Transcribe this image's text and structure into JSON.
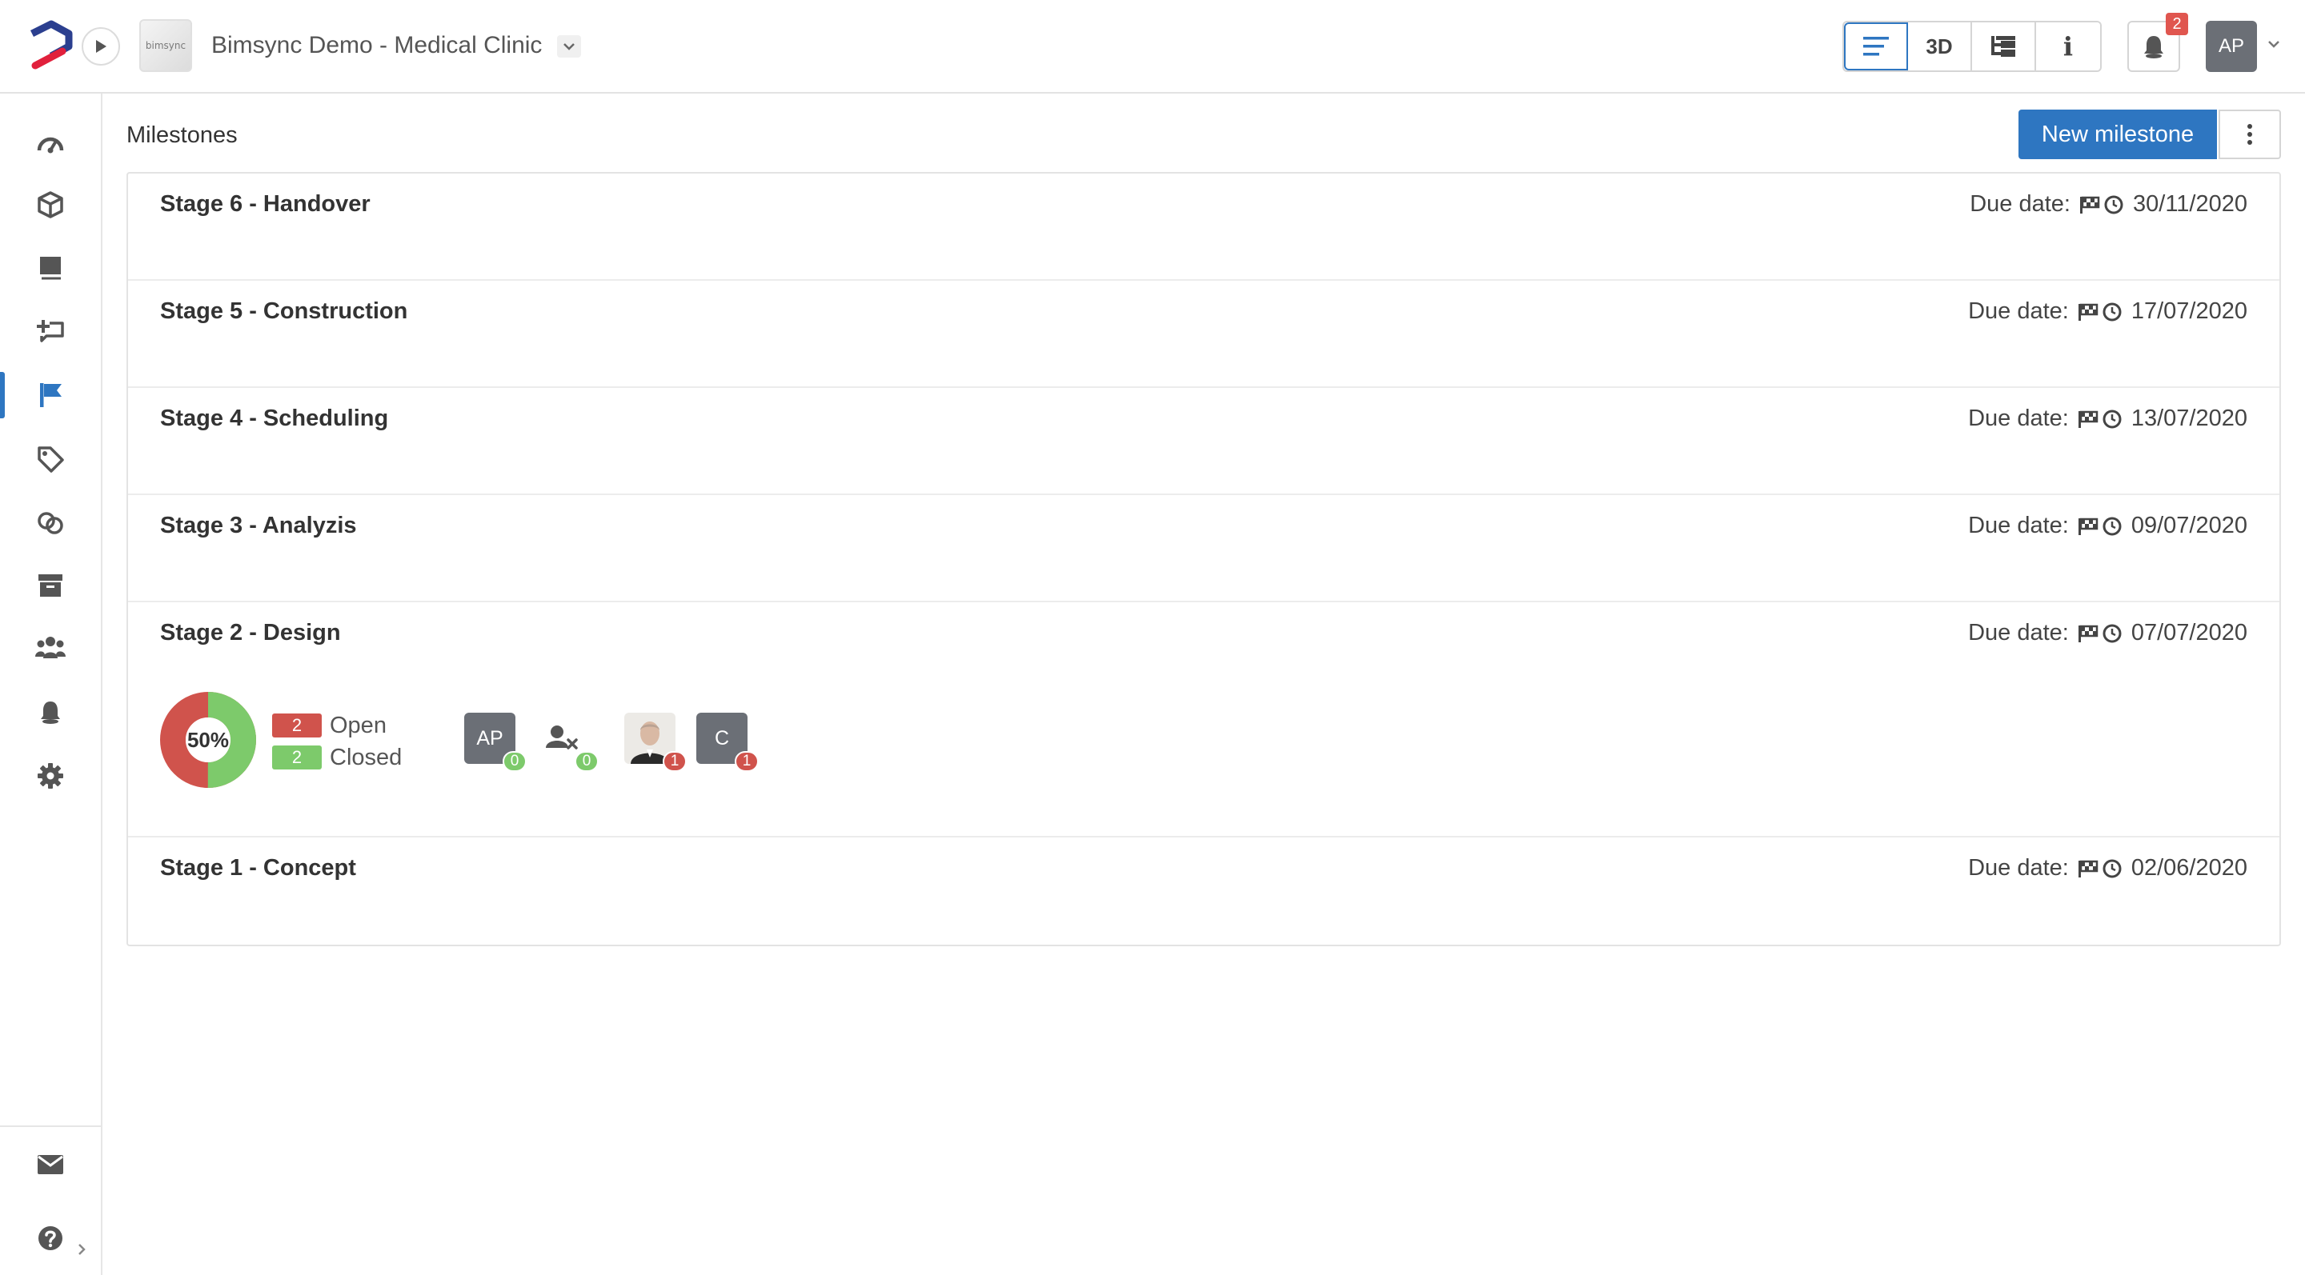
{
  "header": {
    "project_name": "Bimsync Demo - Medical Clinic",
    "project_thumb_text": "bimsync",
    "view_buttons": [
      {
        "icon": "list-icon",
        "label": ""
      },
      {
        "icon": "3d-icon",
        "label": "3D"
      },
      {
        "icon": "tree-icon",
        "label": ""
      },
      {
        "icon": "info-icon",
        "label": "i"
      }
    ],
    "notification_count": "2",
    "user_initials": "AP"
  },
  "sidebar": {
    "items": [
      {
        "icon": "dashboard-icon"
      },
      {
        "icon": "cube-icon"
      },
      {
        "icon": "library-icon"
      },
      {
        "icon": "issues-icon"
      },
      {
        "icon": "flag-icon",
        "active": true
      },
      {
        "icon": "tag-icon"
      },
      {
        "icon": "link-icon"
      },
      {
        "icon": "archive-icon"
      },
      {
        "icon": "team-icon"
      },
      {
        "icon": "bell-icon"
      },
      {
        "icon": "gear-icon"
      }
    ],
    "bottom": [
      {
        "icon": "mail-icon"
      },
      {
        "icon": "help-icon"
      }
    ]
  },
  "main": {
    "title": "Milestones",
    "new_button": "New milestone",
    "due_label": "Due date:",
    "milestones": [
      {
        "name": "Stage 6 - Handover",
        "due": "30/11/2020"
      },
      {
        "name": "Stage 5 - Construction",
        "due": "17/07/2020"
      },
      {
        "name": "Stage 4 - Scheduling",
        "due": "13/07/2020"
      },
      {
        "name": "Stage 3 - Analyzis",
        "due": "09/07/2020"
      },
      {
        "name": "Stage 2 - Design",
        "due": "07/07/2020"
      },
      {
        "name": "Stage 1 - Concept",
        "due": "02/06/2020"
      }
    ],
    "design_stats": {
      "percent": 0.5,
      "percent_label": "50%",
      "open_count": "2",
      "open_label": "Open",
      "closed_count": "2",
      "closed_label": "Closed",
      "assignees": [
        {
          "initials": "AP",
          "count": "0",
          "status": "ok"
        },
        {
          "initials": "",
          "icon": "unassigned-user-icon",
          "count": "0",
          "status": "ok"
        },
        {
          "initials": "",
          "icon": "photo-avatar",
          "count": "1",
          "status": "open"
        },
        {
          "initials": "C",
          "count": "1",
          "status": "open"
        }
      ]
    }
  },
  "colors": {
    "primary": "#2e76c1",
    "open": "#d0534c",
    "closed": "#7dca6b",
    "avatar": "#6b6f76",
    "logo_blue": "#2b3f8f",
    "logo_red": "#e1203c"
  }
}
